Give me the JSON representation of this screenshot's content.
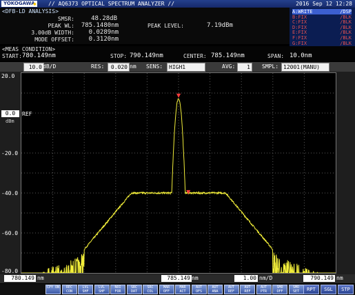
{
  "title_bar": {
    "logo": "YOKOGAWA",
    "logo_mark": "◆",
    "instrument": "// AQ6373 OPTICAL SPECTRUM ANALYZER //",
    "datetime": "2016 Sep 12 12:28"
  },
  "analysis": {
    "title": "<DFB-LD ANALYSIS>",
    "smsr_label": "SMSR:",
    "smsr_value": "48.28dB",
    "peak_wl_label": "PEAK WL:",
    "peak_wl_value": "785.1480nm",
    "width_label": "3.00dB WIDTH:",
    "width_value": "0.0289nm",
    "mode_offset_label": "MODE OFFSET:",
    "mode_offset_value": "0.3120nm",
    "peak_level_label": "PEAK LEVEL:",
    "peak_level_value": "7.19dBm"
  },
  "traces": [
    {
      "left": "A:WRITE",
      "right": "/DSP",
      "active": true
    },
    {
      "left": "B:FIX",
      "right": "/BLK",
      "active": false
    },
    {
      "left": "C:FIX",
      "right": "/BLK",
      "active": false
    },
    {
      "left": "D:FIX",
      "right": "/BLK",
      "active": false
    },
    {
      "left": "E:FIX",
      "right": "/BLK",
      "active": false
    },
    {
      "left": "F:FIX",
      "right": "/BLK",
      "active": false
    },
    {
      "left": "G:FIX",
      "right": "/BLK",
      "active": false
    }
  ],
  "meas": {
    "title": "<MEAS CONDITION>",
    "start_label": "START:",
    "start_value": "780.149nm",
    "stop_label": "STOP:",
    "stop_value": "790.149nm",
    "center_label": "CENTER:",
    "center_value": "785.149nm",
    "span_label": "SPAN:",
    "span_value": "10.0nm"
  },
  "params": {
    "scale_value": "10.0",
    "scale_unit": "dB/D",
    "res_label": "RES:",
    "res_value": "0.020",
    "res_unit": "nm",
    "sens_label": "SENS:",
    "sens_value": "HIGH1",
    "avg_label": "AVG:",
    "avg_value": "1",
    "smpl_label": "SMPL:",
    "smpl_value": "12001(MANU)"
  },
  "plot": {
    "y_ticks": [
      "20.0",
      "-20.0",
      "-40.0",
      "-60.0",
      "-80.0"
    ],
    "ref_value": "0.0",
    "ref_label": "REF",
    "ref_unit": "dBm"
  },
  "bottom": {
    "start_value": "780.149",
    "start_unit": "nm",
    "center_value": "785.149",
    "center_unit": "nm",
    "div_value": "1.00",
    "div_unit": "nm/D",
    "stop_value": "790.149",
    "stop_unit": "nm"
  },
  "softkeys": [
    "CPY ON",
    "REC CON",
    "LVL SHF",
    "LVL SHF",
    "NOI FOR",
    "SRC DAT",
    "SRC COL",
    "MAR OFF",
    "MAR ACT",
    "AUT OFS",
    "AUT ANA",
    "AUT REF",
    "AUT REF",
    "AUT PTR",
    "SMO OFF",
    "SMO SET"
  ],
  "softkey_buttons": [
    "RPT",
    "SGL",
    "STP"
  ],
  "colors": {
    "trace": "#f2ee3a",
    "marker": "#ff3b3b",
    "grid": "#5a5a5a",
    "title_bar": "#1a2f7a",
    "softkey": "#5f7cc8"
  }
}
